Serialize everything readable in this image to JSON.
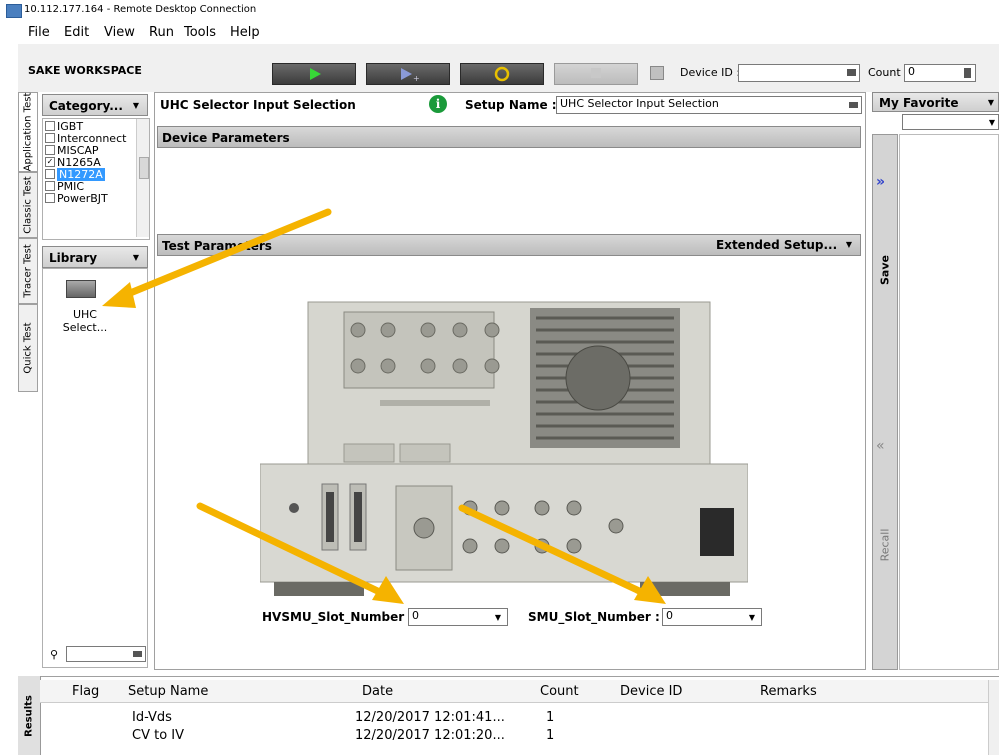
{
  "window": {
    "title": "10.112.177.164 - Remote Desktop Connection"
  },
  "menu": [
    "File",
    "Edit",
    "View",
    "Run",
    "Tools",
    "Help"
  ],
  "toolbar": {
    "workspace_label": "SAKE WORKSPACE",
    "device_id_label": "Device ID :",
    "device_id_value": "",
    "count_label": "Count :",
    "count_value": "0"
  },
  "side_tabs": [
    "Application Test",
    "Classic Test",
    "Tracer Test",
    "Quick Test"
  ],
  "category": {
    "label": "Category...",
    "items": [
      {
        "label": "IGBT",
        "checked": false,
        "selected": false
      },
      {
        "label": "Interconnect",
        "checked": false,
        "selected": false
      },
      {
        "label": "MISCAP",
        "checked": false,
        "selected": false
      },
      {
        "label": "N1265A",
        "checked": true,
        "selected": false
      },
      {
        "label": "N1272A",
        "checked": false,
        "selected": true
      },
      {
        "label": "PMIC",
        "checked": false,
        "selected": false
      },
      {
        "label": "PowerBJT",
        "checked": false,
        "selected": false
      }
    ]
  },
  "library": {
    "label": "Library",
    "item_label_line1": "UHC",
    "item_label_line2": "Select..."
  },
  "main": {
    "title": "UHC Selector Input Selection",
    "setup_name_label": "Setup Name :",
    "setup_name_value": "UHC Selector Input Selection",
    "device_params": "Device Parameters",
    "test_params": "Test Parameters",
    "extended_setup": "Extended Setup...",
    "hvsmu_label": "HVSMU_Slot_Number :",
    "hvsmu_value": "0",
    "smu_label": "SMU_Slot_Number :",
    "smu_value": "0"
  },
  "right": {
    "favorite_label": "My Favorite",
    "save_label": "Save",
    "recall_label": "Recall"
  },
  "results": {
    "tab_label": "Results",
    "columns": [
      "Flag",
      "Setup Name",
      "Date",
      "Count",
      "Device ID",
      "Remarks"
    ],
    "rows": [
      {
        "setup": "Id-Vds",
        "date": "12/20/2017 12:01:41...",
        "count": "1"
      },
      {
        "setup": "CV to IV",
        "date": "12/20/2017 12:01:20...",
        "count": "1"
      }
    ]
  },
  "colors": {
    "annotation_arrow": "#f5b300",
    "selected_item": "#3399ff",
    "play_green": "#37d837"
  }
}
